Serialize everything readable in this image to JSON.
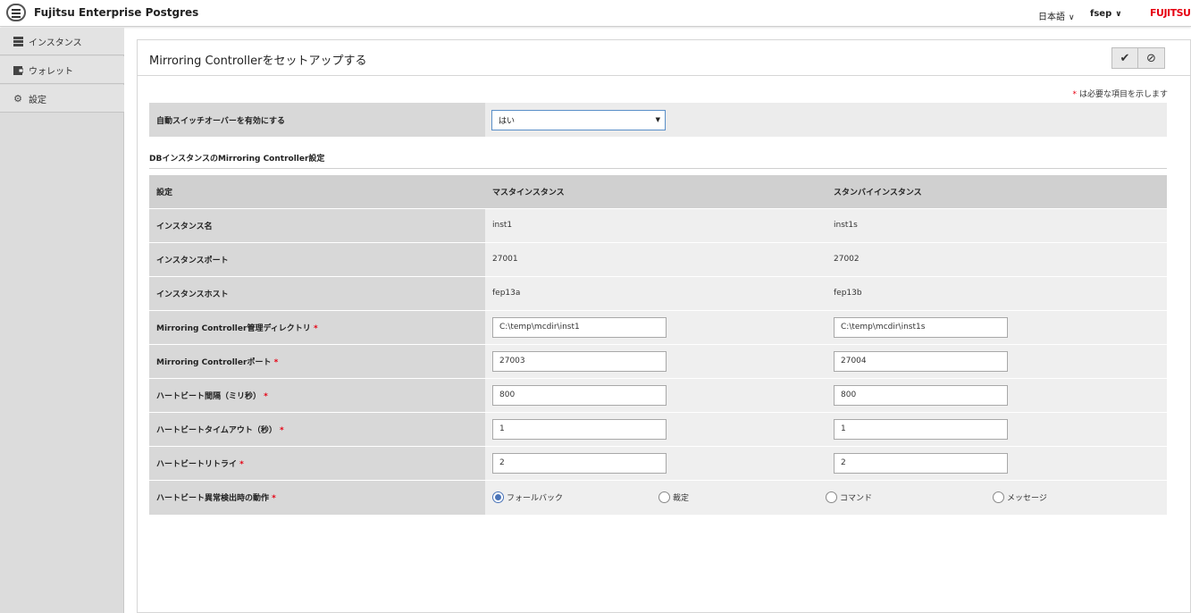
{
  "header": {
    "app_title": "Fujitsu Enterprise Postgres",
    "language": "日本語",
    "user": "fsep",
    "logo_text": "FUJITSU"
  },
  "sidebar": {
    "items": [
      {
        "label": "インスタンス",
        "icon": "database-icon"
      },
      {
        "label": "ウォレット",
        "icon": "wallet-icon"
      },
      {
        "label": "設定",
        "icon": "gear-icon"
      }
    ]
  },
  "panel": {
    "title": "Mirroring Controllerをセットアップする",
    "required_note": "は必要な項目を示します",
    "required_star": "*",
    "auto_switchover": {
      "label": "自動スイッチオーバーを有効にする",
      "value": "はい"
    },
    "section_title": "DBインスタンスのMirroring Controller設定",
    "columns": [
      "設定",
      "マスタインスタンス",
      "スタンバイインスタンス"
    ],
    "rows": {
      "instance_name": {
        "label": "インスタンス名",
        "master": "inst1",
        "standby": "inst1s"
      },
      "instance_port": {
        "label": "インスタンスポート",
        "master": "27001",
        "standby": "27002"
      },
      "instance_host": {
        "label": "インスタンスホスト",
        "master": "fep13a",
        "standby": "fep13b"
      },
      "mc_dir": {
        "label": "Mirroring Controller管理ディレクトリ",
        "master": "C:\\temp\\mcdir\\inst1",
        "standby": "C:\\temp\\mcdir\\inst1s"
      },
      "mc_port": {
        "label": "Mirroring Controllerポート",
        "master": "27003",
        "standby": "27004"
      },
      "hb_interval": {
        "label": "ハートビート間隔（ミリ秒）",
        "master": "800",
        "standby": "800"
      },
      "hb_timeout": {
        "label": "ハートビートタイムアウト（秒）",
        "master": "1",
        "standby": "1"
      },
      "hb_retry": {
        "label": "ハートビートリトライ",
        "master": "2",
        "standby": "2"
      },
      "hb_action": {
        "label": "ハートビート異常検出時の動作",
        "options": [
          "フォールバック",
          "裁定",
          "コマンド",
          "メッセージ"
        ],
        "selected": "フォールバック"
      }
    }
  },
  "colors": {
    "accent": "#4a74b8",
    "required": "#e60012",
    "brand": "#e60012"
  }
}
